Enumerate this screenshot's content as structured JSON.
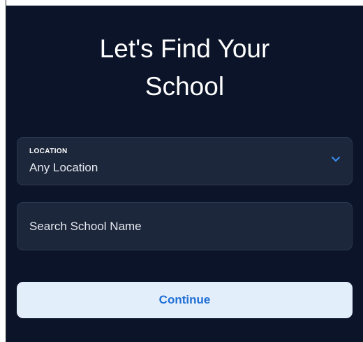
{
  "header": {
    "title_line1": "Let's Find Your",
    "title_line2": "School"
  },
  "location": {
    "label": "LOCATION",
    "value": "Any Location",
    "dropdown_icon": "chevron-down-icon"
  },
  "search": {
    "placeholder": "Search School Name",
    "value": ""
  },
  "actions": {
    "continue_label": "Continue"
  },
  "colors": {
    "background": "#0b1428",
    "field_background": "#1c273b",
    "button_background": "#e3eefb",
    "accent": "#1f6fd6"
  }
}
